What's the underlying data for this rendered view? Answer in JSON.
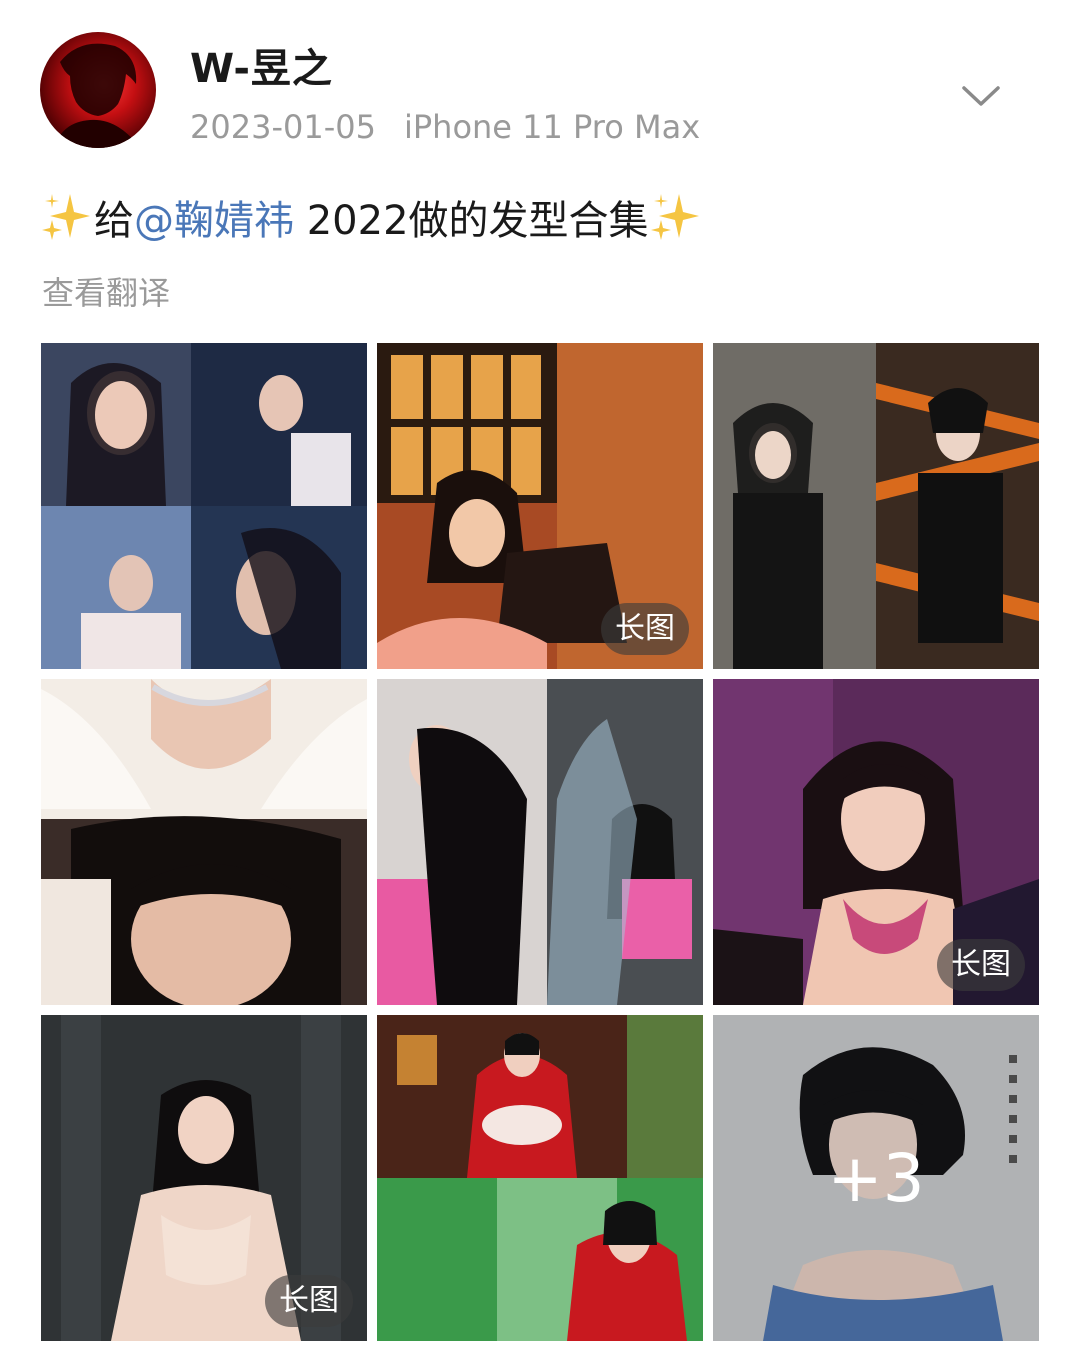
{
  "header": {
    "username": "W-昱之",
    "date": "2023-01-05",
    "device": "iPhone 11 Pro Max"
  },
  "post": {
    "text_prefix": "给",
    "mention": "@鞠婧祎",
    "text_suffix": " 2022做的发型合集",
    "translate_label": "查看翻译"
  },
  "photos": [
    {
      "badge": ""
    },
    {
      "badge": "长图"
    },
    {
      "badge": ""
    },
    {
      "badge": ""
    },
    {
      "badge": ""
    },
    {
      "badge": "长图"
    },
    {
      "badge": "长图"
    },
    {
      "badge": ""
    },
    {
      "badge": "",
      "more_count": "+3"
    }
  ],
  "colors": {
    "mention": "#4a77b8",
    "meta": "#9a9a9a"
  }
}
